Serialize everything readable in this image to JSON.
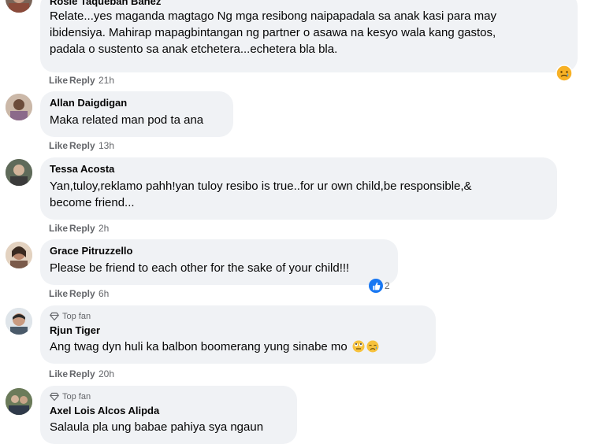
{
  "comments": [
    {
      "name": "Rosie Taqueban Bañez",
      "lines": [
        "Relate...yes maganda magtago Ng mga resibong naipapadala sa anak kasi para may",
        "ibidensiya. Mahirap mapagbintangan ng partner o asawa na kesyo wala kang gastos,",
        "padala o sustento sa anak etchetera...echetera bla bla."
      ],
      "like": "Like",
      "reply": "Reply",
      "time": "21h",
      "reaction": "sad-reaction"
    },
    {
      "name": "Allan Daigdigan",
      "lines": [
        "Maka related man pod ta ana"
      ],
      "like": "Like",
      "reply": "Reply",
      "time": "13h"
    },
    {
      "name": "Tessa Acosta",
      "lines": [
        "Yan,tuloy,reklamo pahh!yan tuloy resibo is true..for ur own child,be responsible,&",
        "become friend..."
      ],
      "like": "Like",
      "reply": "Reply",
      "time": "2h"
    },
    {
      "name": "Grace Pitruzzello",
      "lines": [
        "Please be friend to each other for the sake of your child!!!"
      ],
      "like": "Like",
      "reply": "Reply",
      "time": "6h",
      "reaction_count": "2"
    },
    {
      "badge": "Top fan",
      "name": "Rjun Tiger",
      "lines": [
        "Ang twag dyn huli ka balbon boomerang yung sinabe mo"
      ],
      "like": "Like",
      "reply": "Reply",
      "time": "20h"
    },
    {
      "badge": "Top fan",
      "name": "Axel Lois Alcos Alipda",
      "lines": [
        "Salaula pla ung babae pahiya sya ngaun"
      ]
    }
  ],
  "colors": {
    "bubble": "#f0f2f5",
    "meta": "#65676b",
    "like_blue": "#1877f2"
  }
}
